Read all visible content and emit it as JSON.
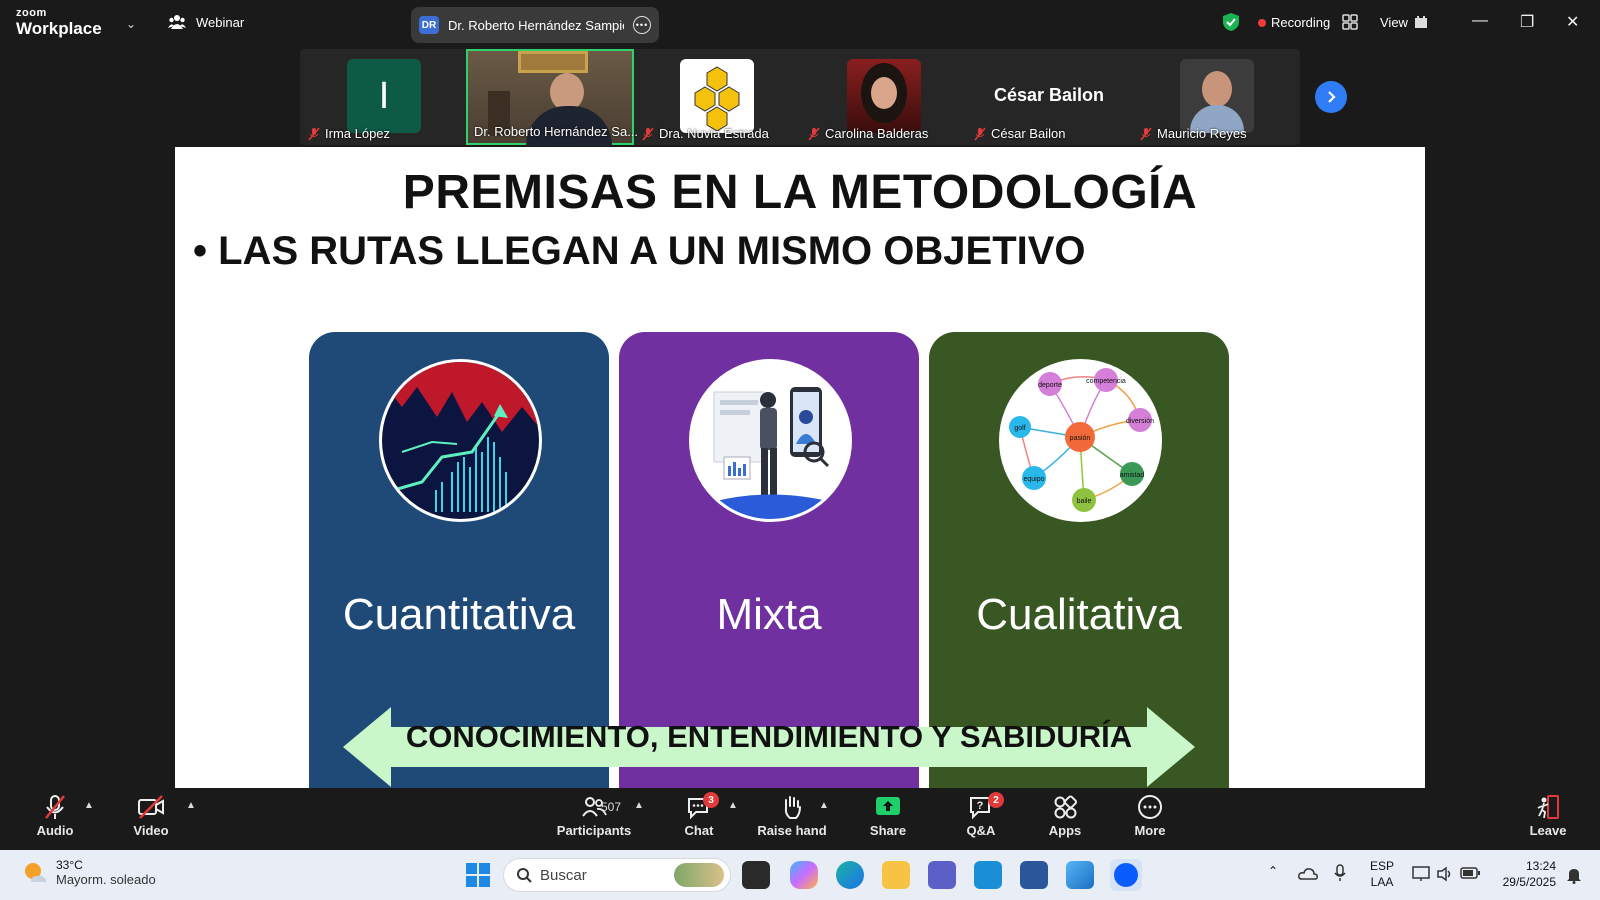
{
  "topbar": {
    "logo_top": "zoom",
    "logo_bottom": "Workplace",
    "webinar_label": "Webinar",
    "meeting_badge": "DR",
    "meeting_name": "Dr. Roberto Hernández Sampieri'",
    "recording_label": "Recording",
    "view_label": "View"
  },
  "participants": [
    {
      "name": "Irma López",
      "initial": "I"
    },
    {
      "name": "Dr. Roberto Hernández Sa..."
    },
    {
      "name": "Dra. Nuvia Estrada"
    },
    {
      "name": "Carolina Balderas"
    },
    {
      "name": "César Bailon",
      "display_text": "César Bailon"
    },
    {
      "name": "Mauricio Reyes"
    }
  ],
  "slide": {
    "title": "PREMISAS EN LA METODOLOGÍA",
    "bullet": "LAS RUTAS LLEGAN A UN MISMO OBJETIVO",
    "columns": [
      {
        "label": "Cuantitativa",
        "color": "#1f4a78"
      },
      {
        "label": "Mixta",
        "color": "#7030a0"
      },
      {
        "label": "Cualitativa",
        "color": "#385723"
      }
    ],
    "network_nodes": [
      "deporte",
      "competencia",
      "diversión",
      "pasión",
      "golf",
      "amistad",
      "equipo",
      "baile"
    ],
    "arrow_text": "CONOCIMIENTO, ENTENDIMIENTO Y SABIDURÍA",
    "arrow_color": "#c9f7c9"
  },
  "controls": {
    "audio": "Audio",
    "video": "Video",
    "participants": "Participants",
    "participants_count": "507",
    "chat": "Chat",
    "chat_badge": "3",
    "raise_hand": "Raise hand",
    "share": "Share",
    "qa": "Q&A",
    "qa_badge": "2",
    "apps": "Apps",
    "more": "More",
    "leave": "Leave"
  },
  "taskbar": {
    "temp": "33°C",
    "weather": "Mayorm. soleado",
    "search_placeholder": "Buscar",
    "lang_top": "ESP",
    "lang_bottom": "LAA",
    "time": "13:24",
    "date": "29/5/2025"
  }
}
